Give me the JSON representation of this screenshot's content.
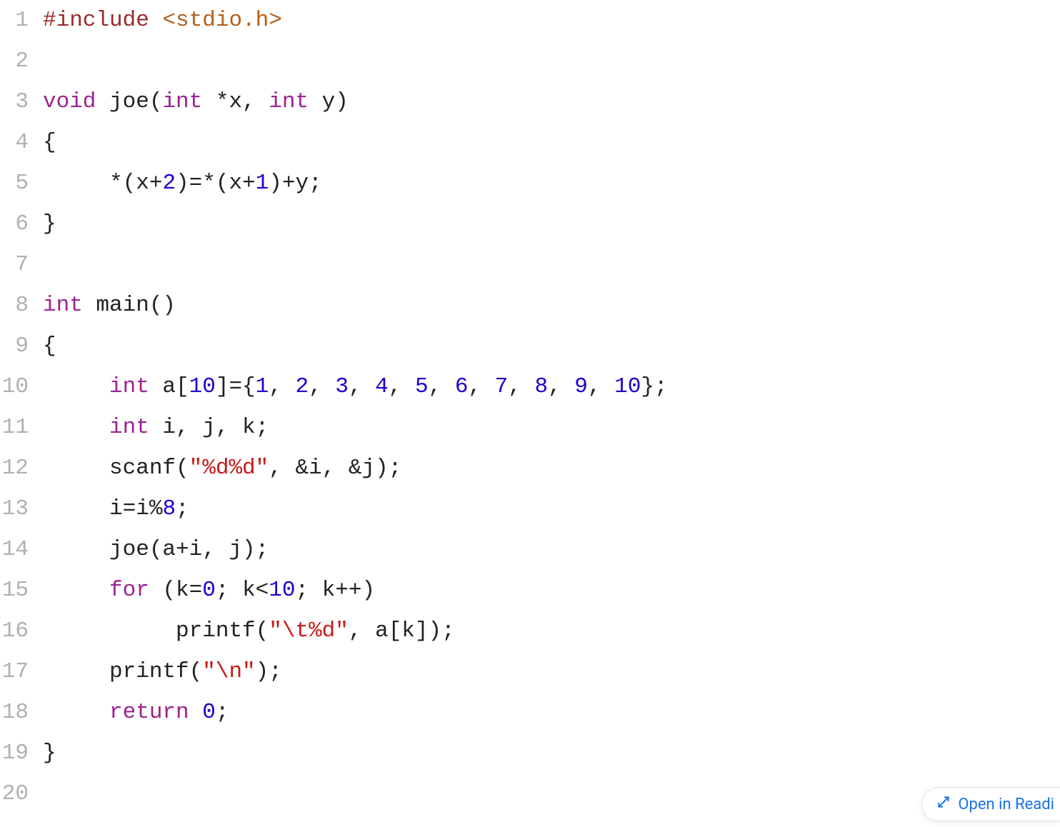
{
  "lineNumbers": [
    "1",
    "2",
    "3",
    "4",
    "5",
    "6",
    "7",
    "8",
    "9",
    "10",
    "11",
    "12",
    "13",
    "14",
    "15",
    "16",
    "17",
    "18",
    "19",
    "20"
  ],
  "code": {
    "l1": {
      "a": "#include",
      "b": " ",
      "c": "<stdio.h>"
    },
    "l2": {
      "a": ""
    },
    "l3": {
      "a": "void",
      "b": " joe(",
      "c": "int",
      "d": " *x, ",
      "e": "int",
      "f": " y)"
    },
    "l4": {
      "a": "{"
    },
    "l5": {
      "a": "     *(x+",
      "b": "2",
      "c": ")=*(x+",
      "d": "1",
      "e": ")+y;"
    },
    "l6": {
      "a": "}"
    },
    "l7": {
      "a": ""
    },
    "l8": {
      "a": "int",
      "b": " main()"
    },
    "l9": {
      "a": "{"
    },
    "l10": {
      "a": "     ",
      "b": "int",
      "c": " a[",
      "d": "10",
      "e": "]={",
      "f": "1",
      "g": ", ",
      "h": "2",
      "i": ", ",
      "j": "3",
      "k": ", ",
      "l": "4",
      "m": ", ",
      "n": "5",
      "o": ", ",
      "p": "6",
      "q": ", ",
      "r": "7",
      "s": ", ",
      "t": "8",
      "u": ", ",
      "v": "9",
      "w": ", ",
      "x": "10",
      "y": "};"
    },
    "l11": {
      "a": "     ",
      "b": "int",
      "c": " i, j, k;"
    },
    "l12": {
      "a": "     scanf(",
      "b": "\"%d%d\"",
      "c": ", &i, &j);"
    },
    "l13": {
      "a": "     i=i%",
      "b": "8",
      "c": ";"
    },
    "l14": {
      "a": "     joe(a+i, j);"
    },
    "l15": {
      "a": "     ",
      "b": "for",
      "c": " (k=",
      "d": "0",
      "e": "; k<",
      "f": "10",
      "g": "; k++)"
    },
    "l16": {
      "a": "          printf(",
      "b": "\"\\t%d\"",
      "c": ", a[k]);"
    },
    "l17": {
      "a": "     printf(",
      "b": "\"\\n\"",
      "c": ");"
    },
    "l18": {
      "a": "     ",
      "b": "return",
      "c": " ",
      "d": "0",
      "e": ";"
    },
    "l19": {
      "a": "}"
    }
  },
  "openButton": {
    "label": "Open in Readi"
  },
  "colors": {
    "keyword": "#9b2393",
    "number": "#1c00cf",
    "string": "#c41a16",
    "preproc": "#9b2b2b",
    "header": "#b55f1a",
    "gutter": "#b0b0b0",
    "link": "#1a73e8"
  }
}
